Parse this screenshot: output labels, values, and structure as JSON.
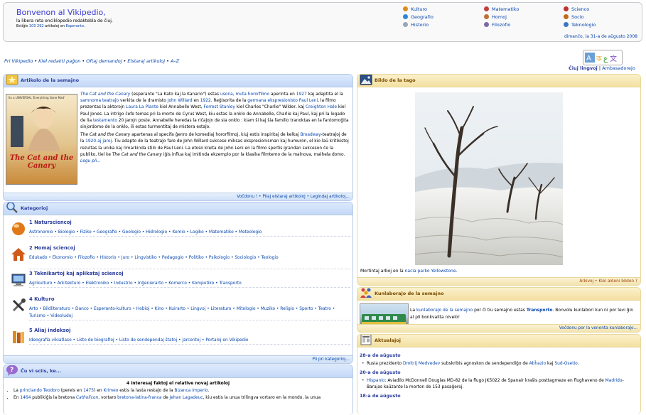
{
  "banner": {
    "welcome": "Bonvenon al Vikipedio,",
    "tagline": "la libera reta enciklopedio redaktebla de ĉiuj.",
    "count_prefix": "Estiĝis",
    "count_number": "103 292",
    "count_middle": "artikoloj en",
    "count_language": "Esperanto.",
    "date": "dimanĉo, la 31-a de aŭgusto 2008",
    "portals": [
      {
        "label": "Kulturo",
        "icon": "culture-icon",
        "color": "#e08a1e"
      },
      {
        "label": "Geografio",
        "icon": "globe-icon",
        "color": "#2f86d6"
      },
      {
        "label": "Historio",
        "icon": "history-icon",
        "color": "#9aa7b8"
      },
      {
        "label": "Matematiko",
        "icon": "math-icon",
        "color": "#c04040"
      },
      {
        "label": "Homoj",
        "icon": "people-icon",
        "color": "#c07030"
      },
      {
        "label": "Filozofio",
        "icon": "philosophy-icon",
        "color": "#7d6aa8"
      },
      {
        "label": "Scienco",
        "icon": "science-icon",
        "color": "#c03030"
      },
      {
        "label": "Socio",
        "icon": "society-icon",
        "color": "#c06a1a"
      },
      {
        "label": "Teknologio",
        "icon": "technology-icon",
        "color": "#3a78c0"
      }
    ]
  },
  "topnav": [
    "Pri Vikipedio",
    "Kiel redakti paĝon",
    "Oftaj demandoj",
    "Elstaraj artikoloj",
    "A–Z"
  ],
  "lang": {
    "all_languages": "Ĉiuj lingvoj",
    "separator": "|",
    "ambassadors": "Ambasadorejo"
  },
  "article": {
    "title": "Artikolo de la semajno",
    "poster_text_top": "Its a UNIVERSAL 'Everything Gone Mad'",
    "poster_title": "The Cat and the Canary",
    "p1": [
      {
        "t": "The Cat and the Canary",
        "k": "link-i"
      },
      {
        "t": " (esperante \"La Kato kaj la Kanario\") estas ",
        "k": "text"
      },
      {
        "t": "usona",
        "k": "link"
      },
      {
        "t": ", ",
        "k": "text"
      },
      {
        "t": "muta",
        "k": "link"
      },
      {
        "t": " ",
        "k": "text"
      },
      {
        "t": "hororfilmo",
        "k": "link"
      },
      {
        "t": " aperinta en ",
        "k": "text"
      },
      {
        "t": "1927",
        "k": "link"
      },
      {
        "t": " kaj adaptita el la ",
        "k": "text"
      },
      {
        "t": "samnoma teatraĵo",
        "k": "link"
      },
      {
        "t": " verkita de la dramisto ",
        "k": "text"
      },
      {
        "t": "John Willard",
        "k": "link"
      },
      {
        "t": " en ",
        "k": "text"
      },
      {
        "t": "1922",
        "k": "link"
      },
      {
        "t": ". Reĝisorita de la ",
        "k": "text"
      },
      {
        "t": "germana ekspresionisto",
        "k": "link"
      },
      {
        "t": " ",
        "k": "text"
      },
      {
        "t": "Paul Leni",
        "k": "link"
      },
      {
        "t": ", la filmo prezentas la aktorojn ",
        "k": "text"
      },
      {
        "t": "Laura La Plante",
        "k": "link"
      },
      {
        "t": " kiel Annabelle West, ",
        "k": "text"
      },
      {
        "t": "Forrest Stanley",
        "k": "link"
      },
      {
        "t": " kiel Charles \"Charlie\" Wilder, kaj ",
        "k": "text"
      },
      {
        "t": "Creighton Hale",
        "k": "link"
      },
      {
        "t": " kiel Paul Jones. La intrigo ĉefe temas pri la morto de Cyrus West, kiu estas la onklo de Annabelle, Charlie kaj Paul, kaj pri la legado de lia ",
        "k": "text"
      },
      {
        "t": "testamento",
        "k": "link"
      },
      {
        "t": " 20 jarojn poste. Annabelle heredas la riĉaĵojn de sia onklo : kiam ŝi kaj ŝia familio tranoktas en la fantomoĝita sinjordomo de la onklo, ili estas turmentitaj de mistera estaĵo.",
        "k": "text"
      }
    ],
    "p2": [
      {
        "t": "The Cat and the Canary",
        "k": "text-i"
      },
      {
        "t": " apartenas al specifa ĝenro de komediaj hororfilmoj, kiuj estis inspiritaj de kelkaj ",
        "k": "text"
      },
      {
        "t": "Broadway",
        "k": "link"
      },
      {
        "t": "-teatraĵoj de la ",
        "k": "text"
      },
      {
        "t": "1920-aj jaroj",
        "k": "link"
      },
      {
        "t": ". Tiu adapto de la teatraĵo fare de John Willard sukcese miksas ekspresionisman kaj humuron, el kio laŭ kritikistoj rezultas la unika kaj rimarkinda stilo de Paul Leni. La etoso kreita de John Leni en la filmo spertis grandan sukceson ĉe la publiko, tiel ke ",
        "k": "text"
      },
      {
        "t": "The Cat and the Canary",
        "k": "text-i"
      },
      {
        "t": " iĝis influa kaj imitinda ekzemplo por la klasika filmtemo de la malnova, malhela domo. ",
        "k": "text"
      },
      {
        "t": "Legu pli...",
        "k": "link-i"
      }
    ],
    "footer": "Voĉdonu ! • Pliaj elstaraj artikoloj • Legindaj artikoloj..."
  },
  "categories": {
    "title": "Kategorioj",
    "items": [
      {
        "title": "1 Natursciencoj",
        "icon": "science-sphere-icon",
        "links": "Astronomio • Biologio • Fiziko • Geografio • Geologio • Hidrologio • Kemio • Logiko • Matematiko • Meteologio"
      },
      {
        "title": "2 Homaj sciencoj",
        "icon": "house-icon",
        "links": "Edukado • Ekonomio • Filozofio • Historio • Juro • Lingvistiko • Pedagogio • Politiko • Psikologio • Sociologio • Teologio"
      },
      {
        "title": "3 Teknikartoj kaj aplikataj sciencoj",
        "icon": "computer-icon",
        "links": "Agrikulturo • Arkitekturo • Elektroniko • Industrio • Inĝenierarto • Komerco • Komputiko • Transporto"
      },
      {
        "title": "4 Kulturo",
        "icon": "tools-icon",
        "links": "Arto • Bildliteraturo • Danco • Esperanto-kulturo • Hobioj • Kino • Kuirarto • Lingvoj • Literaturo • Mitologio • Muziko • Religio • Sporto • Teatro • Turismo • Videoludoj"
      },
      {
        "title": "5 Aliaj indeksoj",
        "icon": "books-icon",
        "links": "Ideografia vikiatlaso • Listo de biografioj • Listo de sendependaj ŝtatoj • Jarcentoj • Portaloj en Vikipedio"
      }
    ],
    "footer": "Pli pri kategorioj..."
  },
  "didyouknow": {
    "title": "Ĉu vi sciis, ke...",
    "subtitle": "4 interesaj faktoj el relative novaj artikoloj",
    "facts": [
      [
        {
          "t": "La ",
          "k": "text"
        },
        {
          "t": "princlando Teodoro",
          "k": "link"
        },
        {
          "t": " (pereis en ",
          "k": "text"
        },
        {
          "t": "1475",
          "k": "link"
        },
        {
          "t": ") en ",
          "k": "text"
        },
        {
          "t": "Krimeo",
          "k": "link"
        },
        {
          "t": " estis la lasta restaĵo de la ",
          "k": "text"
        },
        {
          "t": "Bizanca imperio",
          "k": "link"
        },
        {
          "t": ".",
          "k": "text"
        }
      ],
      [
        {
          "t": "En ",
          "k": "text"
        },
        {
          "t": "1464",
          "k": "link"
        },
        {
          "t": " publikiĝis la bretona ",
          "k": "text"
        },
        {
          "t": "Catholicon",
          "k": "link-i"
        },
        {
          "t": ", vortaro ",
          "k": "text"
        },
        {
          "t": "bretona-latina-franca",
          "k": "link"
        },
        {
          "t": " de ",
          "k": "text"
        },
        {
          "t": "Jehan Lagadeuc",
          "k": "link"
        },
        {
          "t": ", kiu estis la unua trilingva vortaro en la mondo, la unua",
          "k": "text"
        }
      ]
    ]
  },
  "picture": {
    "title": "Bildo de la tago",
    "caption_prefix": "Mortintaj arboj en la ",
    "caption_link": "nacia parko Yellowstone",
    "caption_suffix": ".",
    "footer": "Arkivoj • Kiel aldoni bildon ?"
  },
  "collab": {
    "title": "Kunlaboraĵo de la semajno",
    "text": [
      {
        "t": "La ",
        "k": "text"
      },
      {
        "t": "kunlaboraĵo de la semajno",
        "k": "link"
      },
      {
        "t": " por ĉi tiu semajno estas ",
        "k": "text"
      },
      {
        "t": "Transporto",
        "k": "link-b"
      },
      {
        "t": ". Bonvolu kunlabori kun ni por levi ĝin al pli bonkvalita nivelo!",
        "k": "text"
      }
    ],
    "footer": "Voĉdonu por la venonta kunlaboraĵo..."
  },
  "news": {
    "title": "Aktualaĵoj",
    "days": [
      {
        "date": "28-a de aŭgusto",
        "items": [
          [
            {
              "t": "Rusia prezidento ",
              "k": "text"
            },
            {
              "t": "Dmitrij Medvedev",
              "k": "link"
            },
            {
              "t": " subskribis agnoskon de sendependiĝo de ",
              "k": "text"
            },
            {
              "t": "Abĥazio",
              "k": "link"
            },
            {
              "t": " kaj ",
              "k": "text"
            },
            {
              "t": "Sud-Osetio",
              "k": "link"
            },
            {
              "t": ".",
              "k": "text"
            }
          ]
        ]
      },
      {
        "date": "20-a de aŭgusto",
        "items": [
          [
            {
              "t": "Hispanio",
              "k": "link"
            },
            {
              "t": ": Aviadilo McDonnell Douglas MD-82 de la flugo JK5022 de Spanair kraŝis posttagmeze en flughaveno de ",
              "k": "text"
            },
            {
              "t": "Madrido",
              "k": "link"
            },
            {
              "t": "-Barajas kaŭzante la morton de 153 pasaĝeroj.",
              "k": "text"
            }
          ]
        ]
      },
      {
        "date": "18-a de aŭgusto",
        "items": []
      }
    ]
  },
  "colors": {
    "link": "#0645ad",
    "box_border": "#b6cbe8",
    "box_head": "#c4d9f7",
    "yellow_head": "#f3e0a0",
    "title_blue": "#2a3c9c"
  }
}
